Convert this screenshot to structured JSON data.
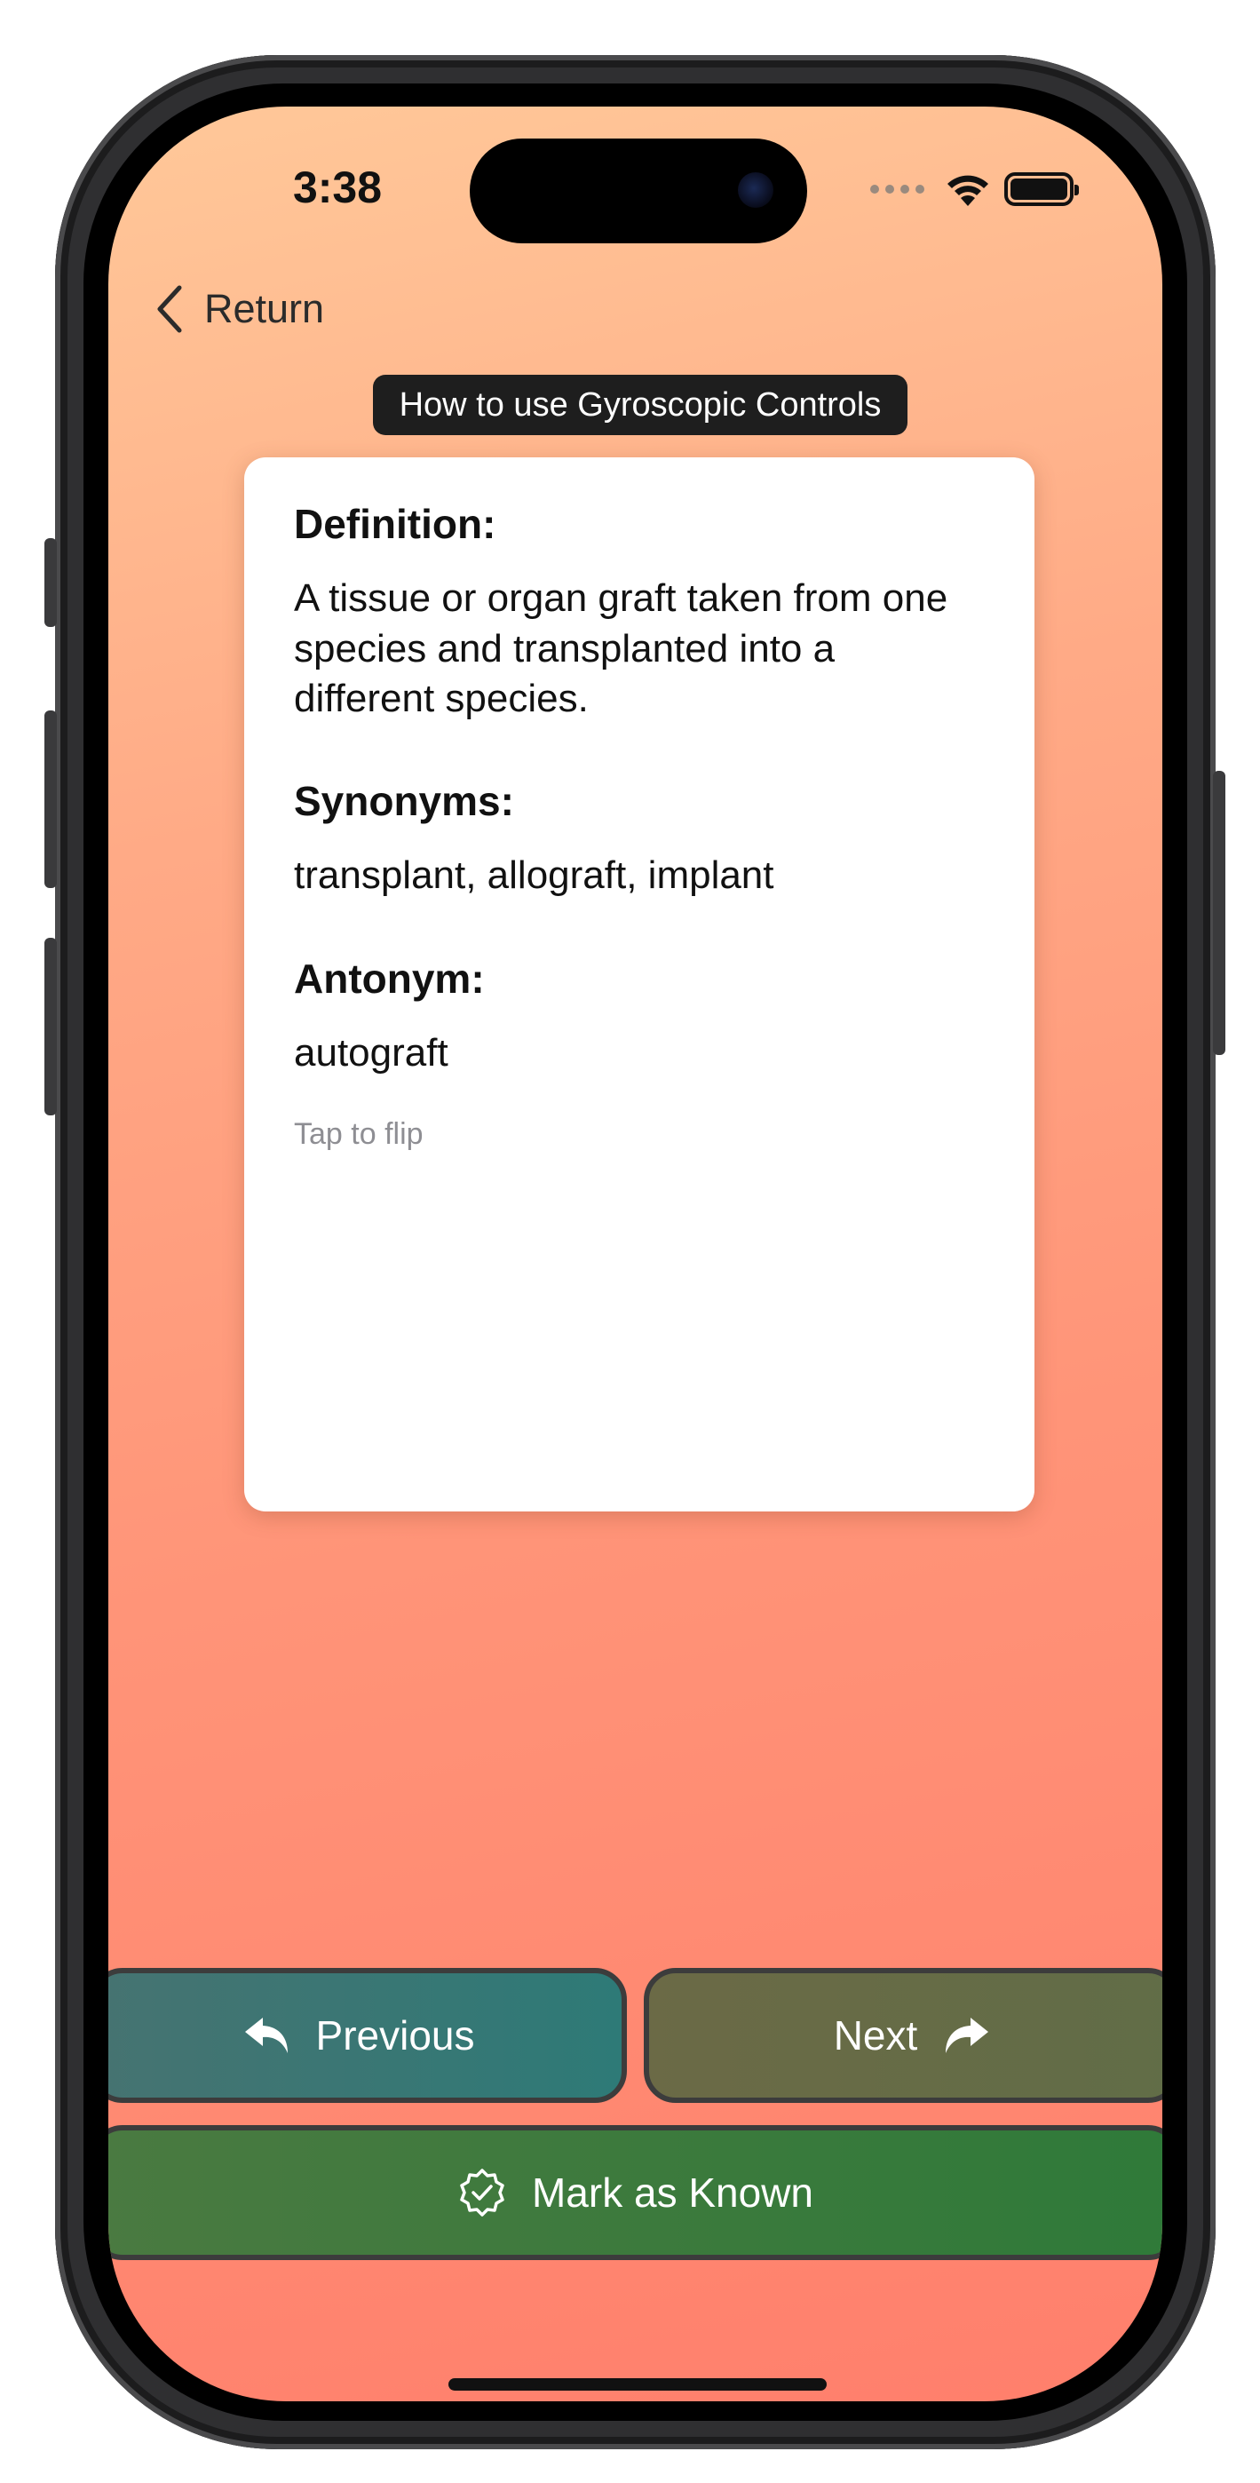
{
  "status_bar": {
    "time": "3:38"
  },
  "nav": {
    "return_label": "Return"
  },
  "tooltip": {
    "text": "How to use Gyroscopic Controls"
  },
  "card": {
    "definition_heading": "Definition:",
    "definition_text": "A tissue or organ graft taken from one species and transplanted into a different species.",
    "synonyms_heading": "Synonyms:",
    "synonyms_text": "transplant, allograft, implant",
    "antonym_heading": "Antonym:",
    "antonym_text": "autograft",
    "hint": "Tap to flip"
  },
  "buttons": {
    "previous_label": "Previous",
    "next_label": "Next",
    "mark_known_label": "Mark as Known"
  },
  "icons": {
    "back": "chevron-left-icon",
    "previous": "reply-arrow-icon",
    "next": "forward-arrow-icon",
    "mark_known": "checkmark-seal-icon",
    "wifi": "wifi-icon",
    "battery": "battery-icon"
  },
  "colors": {
    "background_top": "#ffc899",
    "background_bottom": "#ff7f6c",
    "previous_button": "#2e7a77",
    "next_button": "#636c47",
    "mark_known_button": "#2f7a39",
    "tooltip_bg": "#1e1e1e"
  }
}
